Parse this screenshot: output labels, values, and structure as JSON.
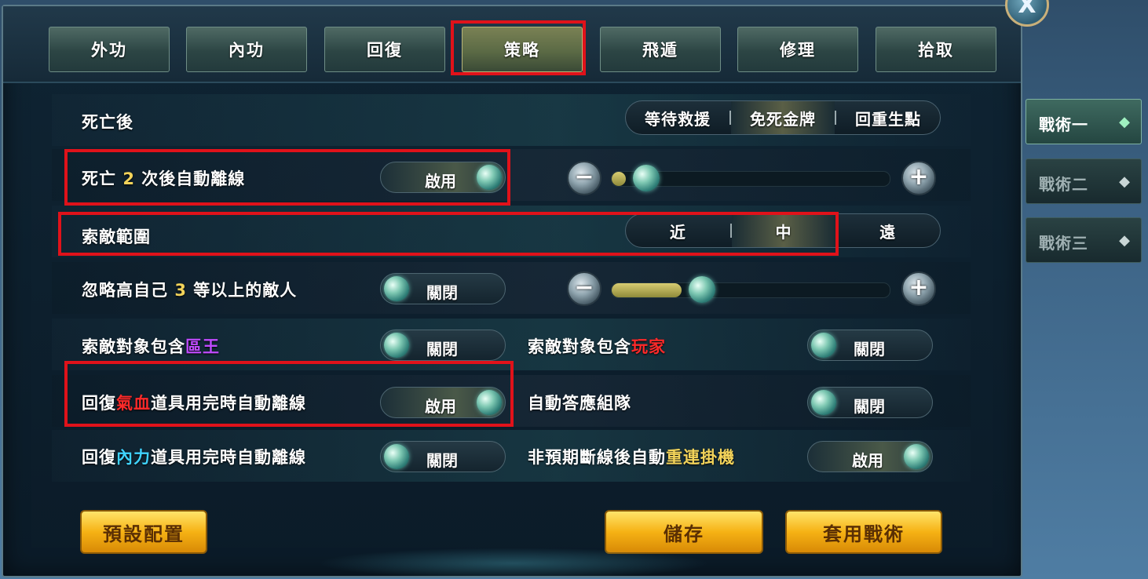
{
  "close_label": "X",
  "tabs": [
    {
      "label": "外功"
    },
    {
      "label": "內功"
    },
    {
      "label": "回復"
    },
    {
      "label": "策略"
    },
    {
      "label": "飛遁"
    },
    {
      "label": "修理"
    },
    {
      "label": "拾取"
    }
  ],
  "active_tab": "策略",
  "side_tabs": [
    {
      "label": "戰術一",
      "icon": "diamond-icon"
    },
    {
      "label": "戰術二",
      "icon": "diamond-icon"
    },
    {
      "label": "戰術三",
      "icon": "diamond-icon"
    }
  ],
  "rows": {
    "after_death": {
      "label": "死亡後",
      "options": [
        "等待救援",
        "免死金牌",
        "回重生點"
      ],
      "selected": "免死金牌"
    },
    "death_logout": {
      "label_pre": "死亡 ",
      "label_num": "2",
      "label_post": " 次後自動離線",
      "toggle": "啟用",
      "slider_fraction": 0.05
    },
    "search_range": {
      "label": "索敵範圍",
      "options": [
        "近",
        "中",
        "遠"
      ],
      "selected": "中"
    },
    "ignore_higher": {
      "label_pre": "忽略高自己 ",
      "label_num": "3",
      "label_post": " 等以上的敵人",
      "toggle": "關閉",
      "slider_fraction": 0.25
    },
    "target_boss": {
      "label_pre": "索敵對象包含",
      "label_hl": "區王",
      "toggle": "關閉"
    },
    "target_player": {
      "label_pre": "索敵對象包含",
      "label_hl": "玩家",
      "toggle": "關閉"
    },
    "hp_logout": {
      "label_pre": "回復",
      "label_hl": "氣血",
      "label_post": "道具用完時自動離線",
      "toggle": "啟用"
    },
    "auto_party": {
      "label": "自動答應組隊",
      "toggle": "關閉"
    },
    "mp_logout": {
      "label_pre": "回復",
      "label_hl": "內力",
      "label_post": "道具用完時自動離線",
      "toggle": "關閉"
    },
    "reconnect": {
      "label_pre": "非預期斷線後自動",
      "label_hl": "重連掛機",
      "toggle": "啟用"
    }
  },
  "buttons": {
    "default_config": "預設配置",
    "save": "儲存",
    "apply_tactic": "套用戰術"
  },
  "colors": {
    "highlight_yellow": "#f2d35a",
    "highlight_red": "#ff2a2a",
    "highlight_purple": "#c04bff",
    "highlight_cyan": "#3fd3ff",
    "annotation_red": "#e0121a"
  }
}
